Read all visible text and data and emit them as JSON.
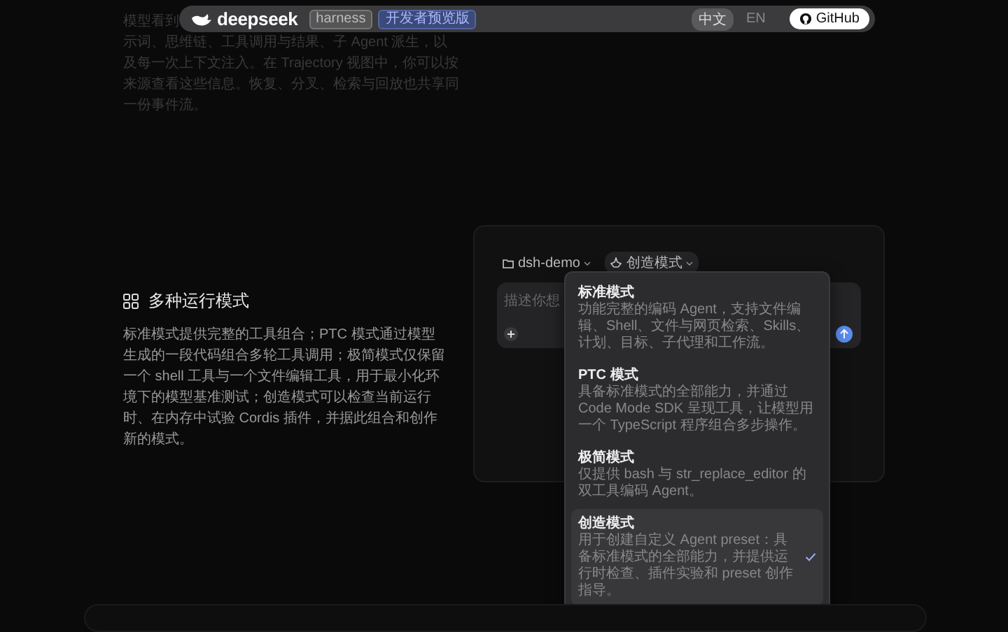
{
  "intro": {
    "fragment": "模型看到",
    "text": "示词、思维链、工具调用与结果、子 Agent 派生，以及每一次上下文注入。在 Trajectory 视图中，你可以按来源查看这些信息。恢复、分叉、检索与回放也共享同一份事件流。"
  },
  "header": {
    "logo": "deepseek",
    "badges": [
      {
        "label": "harness",
        "kind": "plain"
      },
      {
        "label": "开发者预览版",
        "kind": "accent"
      }
    ],
    "languages": [
      {
        "label": "中文",
        "selected": true
      },
      {
        "label": "EN",
        "selected": false
      }
    ],
    "github": "GitHub"
  },
  "section": {
    "title": "多种运行模式",
    "body": "标准模式提供完整的工具组合；PTC 模式通过模型生成的一段代码组合多轮工具调用；极简模式仅保留一个 shell 工具与一个文件编辑工具，用于最小化环境下的模型基准测试；创造模式可以检查当前运行时、在内存中试验 Cordis 插件，并据此组合和创作新的模式。"
  },
  "demo": {
    "project": "dsh-demo",
    "mode": "创造模式",
    "placeholder": "描述你想",
    "menu": [
      {
        "title": "标准模式",
        "description": "功能完整的编码 Agent，支持文件编辑、Shell、文件与网页检索、Skills、计划、目标、子代理和工作流。",
        "selected": false
      },
      {
        "title": "PTC 模式",
        "description": "具备标准模式的全部能力，并通过 Code Mode SDK 呈现工具，让模型用一个 TypeScript 程序组合多步操作。",
        "selected": false
      },
      {
        "title": "极简模式",
        "description": "仅提供 bash 与 str_replace_editor 的双工具编码 Agent。",
        "selected": false
      },
      {
        "title": "创造模式",
        "description": "用于创建自定义 Agent preset：具备标准模式的全部能力，并提供运行时检查、插件实验和 preset 创作指导。",
        "selected": true
      }
    ]
  }
}
